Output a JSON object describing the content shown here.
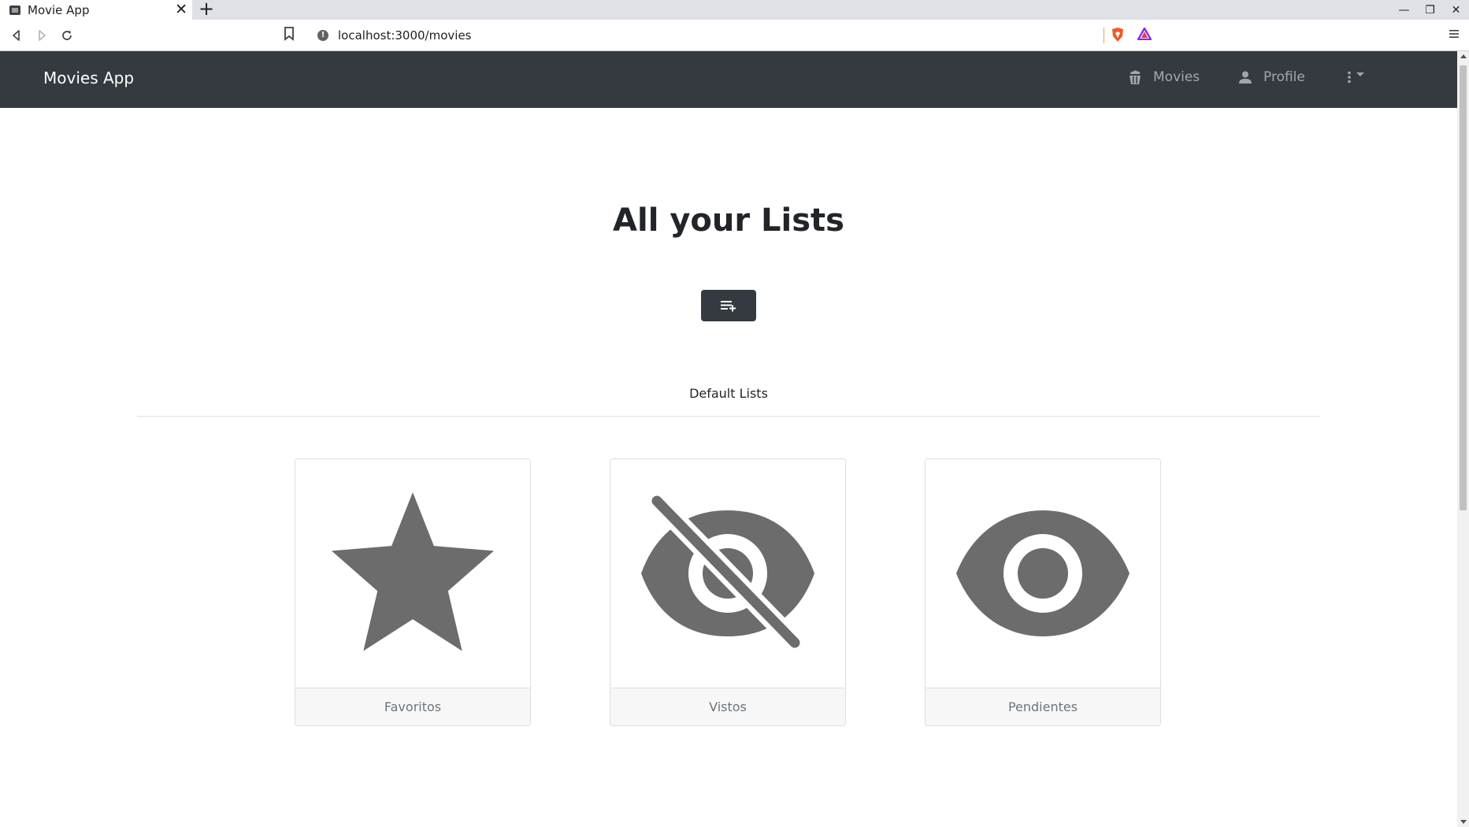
{
  "browser": {
    "tab_title": "Movie App",
    "new_tab": "+",
    "tab_close": "✕",
    "url": "localhost:3000/movies",
    "win_minimize": "—",
    "win_restore": "❐",
    "win_close": "✕"
  },
  "navbar": {
    "brand": "Movies App",
    "links": [
      {
        "label": "Movies",
        "icon": "popcorn-icon"
      },
      {
        "label": "Profile",
        "icon": "person-icon"
      }
    ],
    "more_icon": "more-vert-icon"
  },
  "main": {
    "title": "All your Lists",
    "add_button_icon": "playlist-add-icon",
    "section_label": "Default Lists",
    "lists": [
      {
        "label": "Favoritos",
        "icon": "star-icon"
      },
      {
        "label": "Vistos",
        "icon": "visibility-off-icon"
      },
      {
        "label": "Pendientes",
        "icon": "visibility-icon"
      }
    ]
  },
  "colors": {
    "navbar_bg": "#343a40",
    "icon_gray": "#6c6c6c",
    "text_dark": "#212529"
  }
}
